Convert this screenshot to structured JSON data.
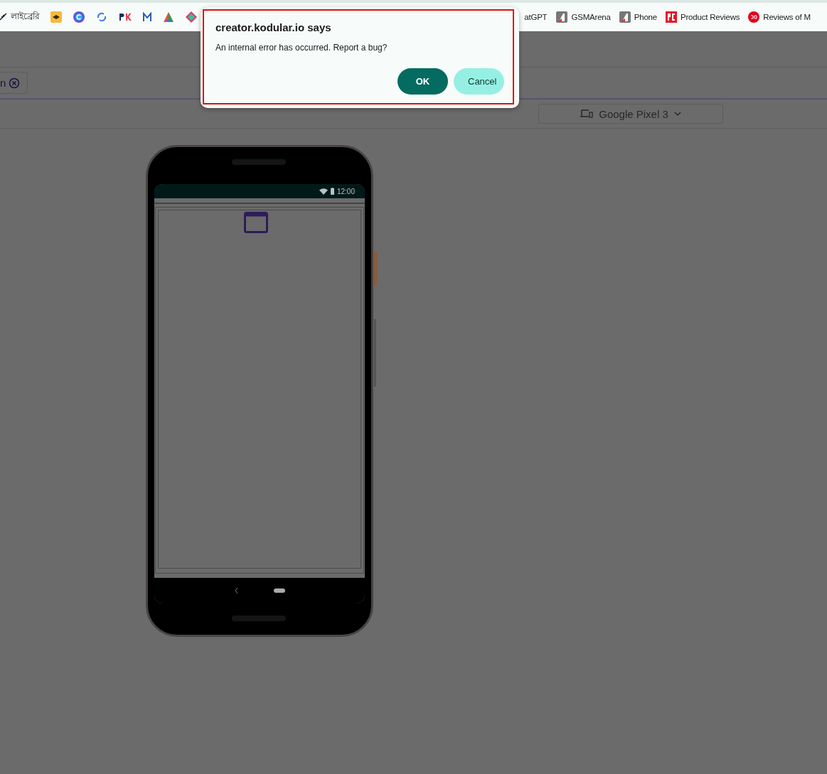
{
  "bookmarks": [
    {
      "kind": "cut",
      "label": "লাইব্রেরি"
    },
    {
      "kind": "stack"
    },
    {
      "kind": "circle-c"
    },
    {
      "kind": "sync"
    },
    {
      "kind": "pk"
    },
    {
      "kind": "m"
    },
    {
      "kind": "triangle"
    },
    {
      "kind": "diamond"
    },
    {
      "kind": "none",
      "label": "atGPT"
    },
    {
      "kind": "gsm",
      "label": "GSMArena"
    },
    {
      "kind": "gsm",
      "label": "Phone"
    },
    {
      "kind": "pc",
      "label": "Product Reviews"
    },
    {
      "kind": "r360",
      "label": "Reviews of M"
    }
  ],
  "tag_chip": {
    "label": "n"
  },
  "device_selector": {
    "label": "Google Pixel 3"
  },
  "phone": {
    "status_time": "12:00"
  },
  "dialog": {
    "title": "creator.kodular.io says",
    "message": "An internal error has occurred. Report a bug?",
    "buttons": [
      {
        "label": "OK",
        "primary": true
      },
      {
        "label": "Cancel",
        "primary": false
      }
    ]
  }
}
